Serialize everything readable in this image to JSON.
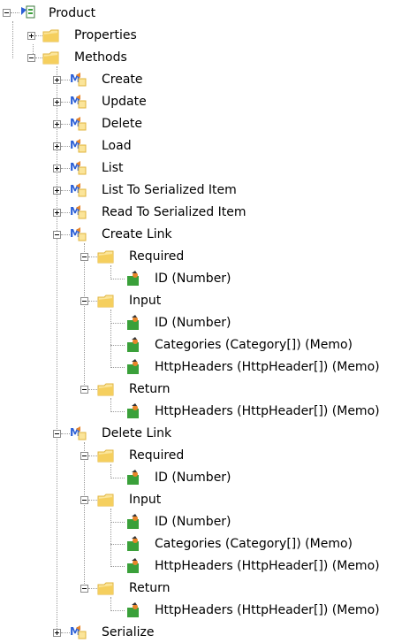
{
  "tree": {
    "root": "Product",
    "properties": "Properties",
    "methods": "Methods",
    "method_items": {
      "create": "Create",
      "update": "Update",
      "delete": "Delete",
      "load": "Load",
      "list": "List",
      "list_to_serialized": "List To Serialized Item",
      "read_to_serialized": "Read To Serialized Item",
      "create_link": "Create Link",
      "delete_link": "Delete Link",
      "serialize": "Serialize"
    },
    "create_link_children": {
      "required": "Required",
      "required_id": "ID (Number)",
      "input": "Input",
      "input_id": "ID (Number)",
      "input_categories": "Categories (Category[]) (Memo)",
      "input_headers": "HttpHeaders (HttpHeader[]) (Memo)",
      "return": "Return",
      "return_headers": "HttpHeaders (HttpHeader[]) (Memo)"
    },
    "delete_link_children": {
      "required": "Required",
      "required_id": "ID (Number)",
      "input": "Input",
      "input_id": "ID (Number)",
      "input_categories": "Categories (Category[]) (Memo)",
      "input_headers": "HttpHeaders (HttpHeader[]) (Memo)",
      "return": "Return",
      "return_headers": "HttpHeaders (HttpHeader[]) (Memo)"
    }
  },
  "icons": {
    "product": "class-icon",
    "folder": "folder-icon",
    "method": "method-icon",
    "property": "property-icon"
  },
  "colors": {
    "folder_light": "#fbe59a",
    "folder_dark": "#e0b43c",
    "method_blue": "#2b5fd6",
    "property_green": "#3aa03a",
    "property_orange": "#e8862a"
  }
}
